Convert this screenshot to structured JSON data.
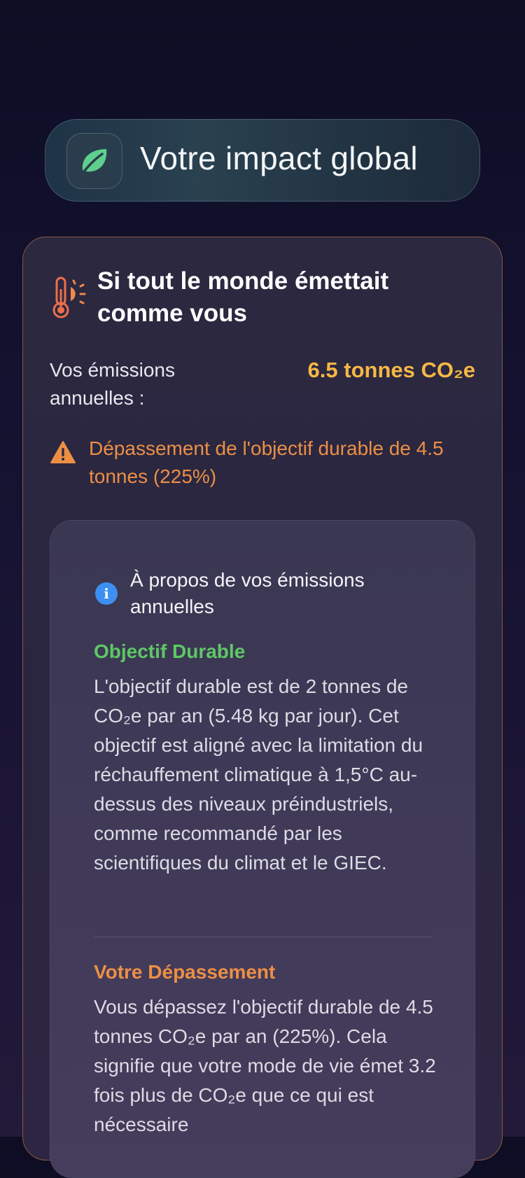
{
  "header": {
    "title": "Votre impact global",
    "icon": "leaf-icon"
  },
  "card": {
    "icon": "thermometer-sun-icon",
    "title": "Si tout le monde émettait comme vous",
    "emissions_label": "Vos émissions annuelles :",
    "emissions_value": "6.5 tonnes CO₂e",
    "warning_icon": "warning-icon",
    "warning_text": "Dépassement de l'objectif durable de 4.5 tonnes (225%)"
  },
  "info": {
    "icon": "info-icon",
    "title": "À propos de vos émissions annuelles",
    "sections": [
      {
        "heading": "Objectif Durable",
        "body": "L'objectif durable est de 2 tonnes de CO₂e par an (5.48 kg par jour). Cet objectif est aligné avec la limitation du réchauffement climatique à 1,5°C au-dessus des niveaux préindustriels, comme recommandé par les scientifiques du climat et le GIEC."
      },
      {
        "heading": "Votre Dépassement",
        "body": "Vous dépassez l'objectif durable de 4.5 tonnes CO₂e par an (225%). Cela signifie que votre mode de vie émet 3.2 fois plus de CO₂e que ce qui est nécessaire"
      }
    ]
  },
  "colors": {
    "accent_yellow": "#f5b843",
    "warning_orange": "#ec8f45",
    "success_green": "#5ec864",
    "info_blue": "#3d8ff2"
  }
}
